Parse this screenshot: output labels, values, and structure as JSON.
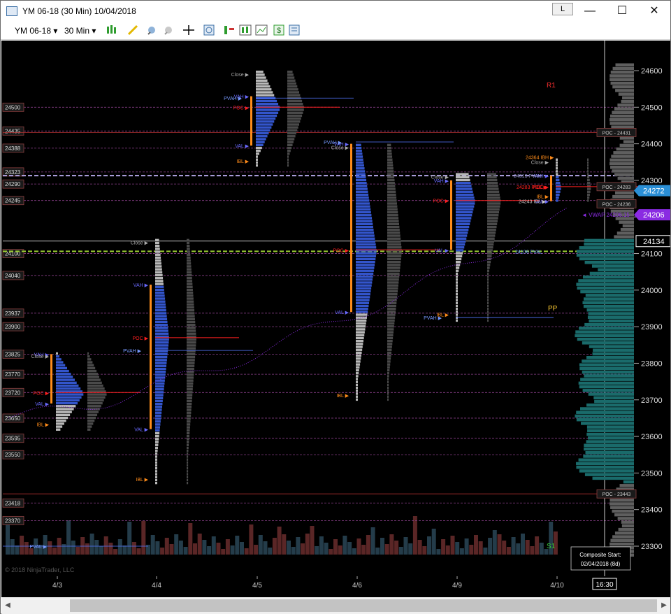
{
  "window": {
    "title": "YM 06-18 (30 Min)  10/04/2018",
    "link_button": "L",
    "minimize": "—",
    "maximize": "☐",
    "close": "✕"
  },
  "toolbar": {
    "instrument": "YM 06-18",
    "interval": "30 Min",
    "dropdown_arrow": "▾"
  },
  "icons": [
    "chart-icon",
    "bars-icon",
    "pencil-icon",
    "zoom-in-icon",
    "zoom-out-icon",
    "crosshair-icon",
    "magnify-icon",
    "strategy-icon",
    "indicator-icon",
    "chart-trader-icon",
    "dollar-icon",
    "properties-icon"
  ],
  "colors": {
    "background": "#000000",
    "profile_blue": "#3355cc",
    "poc_red": "#ff2020",
    "ib_orange": "#ff8c1a",
    "vwap_purple": "#8a2be2",
    "composite_teal": "#1a6b6b",
    "level_purple": "#8a3f8a"
  },
  "price_axis": {
    "ticks": [
      "24600",
      "24500",
      "24400",
      "24300",
      "24200",
      "24100",
      "24000",
      "23900",
      "23800",
      "23700",
      "23600",
      "23500",
      "23400",
      "23300"
    ],
    "current_price": "24272",
    "vwap_price": "24206",
    "crosshair_price": "24134"
  },
  "left_levels": [
    "24500",
    "24435",
    "24388",
    "24323",
    "24290",
    "24245",
    "24100",
    "24040",
    "23937",
    "23900",
    "23825",
    "23770",
    "23720",
    "23650",
    "23595",
    "23550",
    "23418",
    "23370"
  ],
  "dates": [
    "4/3",
    "4/4",
    "4/5",
    "4/6",
    "4/9",
    "4/10"
  ],
  "time_marker": "16:30",
  "labels": {
    "r1": "R1",
    "pp": "PP",
    "s1": "S1",
    "vwap": "◄ VWAP  24206.15",
    "poc_24431": "POC - 24431",
    "poc_24283": "POC - 24283",
    "poc_24236": "POC - 24236",
    "poc_23443": "POC - 23443",
    "ibh_24364": "24364 IBH ▶",
    "poc_24283_left": "24283 POC ▶",
    "ibl_24243": "24243 IBL ▶",
    "pvah_day5": "24313 PVAH",
    "pval_day5": "24106 PVAL",
    "vah": "VAH ▶",
    "val": "VAL ▶",
    "poc": "POC ▶",
    "ibh": "IBH ▶",
    "ibl": "IBL ▶",
    "close": "Close ▶",
    "open": "Open ▶",
    "pvah": "PVAH ▶",
    "pval": "PVAL ▶",
    "composite": "Composite Start:",
    "composite_date": "02/04/2018 (8d)",
    "copyright": "© 2018 NinjaTrader, LLC"
  },
  "chart_data": {
    "type": "bar",
    "title": "YM 06-18 (30 Min)",
    "xlabel": "",
    "ylabel": "",
    "ylim": [
      23250,
      24650
    ],
    "categories": [
      "4/3",
      "4/4",
      "4/5",
      "4/6",
      "4/9",
      "4/10"
    ],
    "series": [
      {
        "name": "POC",
        "values": [
          23720,
          23870,
          24500,
          24110,
          24245,
          24283
        ]
      },
      {
        "name": "VAH",
        "values": [
          23825,
          24015,
          24530,
          24400,
          24300,
          24313
        ]
      },
      {
        "name": "VAL",
        "values": [
          23690,
          23620,
          24395,
          23940,
          24110,
          24243
        ]
      }
    ],
    "reference_levels": {
      "R1": 24560,
      "PP": 23950,
      "S1": 23290,
      "VWAP": 24206.15,
      "Composite POC": 23443
    },
    "grid": false
  }
}
